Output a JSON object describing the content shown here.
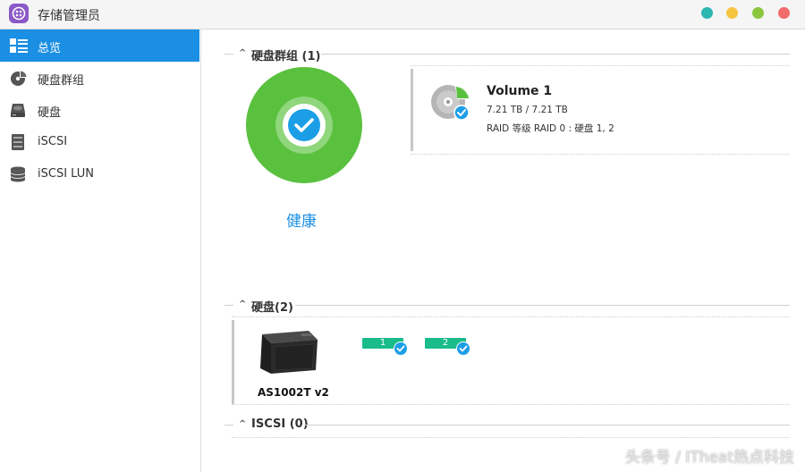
{
  "window": {
    "title": "存储管理员",
    "app_icon": "storage-manager-icon",
    "controls": [
      {
        "name": "teal-button",
        "color": "#2bb7b0"
      },
      {
        "name": "yellow-button",
        "color": "#f5c542"
      },
      {
        "name": "green-button",
        "color": "#8cc63f"
      },
      {
        "name": "red-button",
        "color": "#f26d6d"
      }
    ]
  },
  "sidebar": {
    "items": [
      {
        "label": "总览",
        "icon": "overview-icon",
        "active": true
      },
      {
        "label": "硬盘群组",
        "icon": "volume-group-icon",
        "active": false
      },
      {
        "label": "硬盘",
        "icon": "disk-icon",
        "active": false
      },
      {
        "label": "iSCSI",
        "icon": "iscsi-icon",
        "active": false
      },
      {
        "label": "iSCSI LUN",
        "icon": "iscsi-lun-icon",
        "active": false
      }
    ]
  },
  "volume_group": {
    "section_title": "硬盘群组 (1)",
    "status_label": "健康",
    "status_color": "#5ac13f",
    "volume": {
      "name": "Volume 1",
      "capacity": "7.21 TB / 7.21 TB",
      "raid": "RAID 等级 RAID 0 : 硬盘 1, 2",
      "usage_fraction": 1.0
    }
  },
  "disks": {
    "section_title": "硬盘(2)",
    "device_name": "AS1002T v2",
    "slots": [
      {
        "label": "1",
        "status": "ok"
      },
      {
        "label": "2",
        "status": "ok"
      }
    ],
    "badge_color": "#1abc8a"
  },
  "iscsi": {
    "section_title": "ISCSI (0)"
  },
  "watermark": "头条号 / ITheat热点科技",
  "colors": {
    "accent": "#1b8fe3",
    "health_green": "#5ac13f",
    "check_blue": "#1b9ee6"
  }
}
